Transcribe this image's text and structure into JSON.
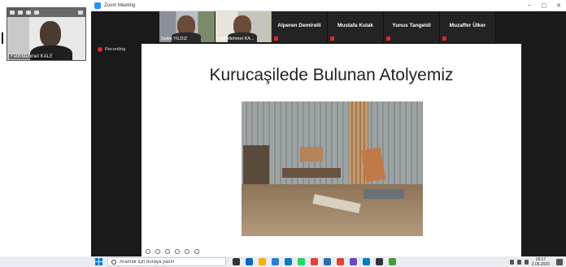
{
  "self_view": {
    "name": "FatihMehmet KALE"
  },
  "zoom": {
    "window_title": "Zoom Meeting",
    "controls": {
      "minimize": "–",
      "maximize": "▢",
      "close": "✕"
    },
    "recording_label": "Recording",
    "participants": [
      {
        "name": "Selim YILDIZ",
        "video": true,
        "active": false
      },
      {
        "name": "FatihMehmet KA...",
        "video": true,
        "active": true
      },
      {
        "name": "Alperen Demirelli",
        "video": false,
        "muted": true
      },
      {
        "name": "Mustafa Kulak",
        "video": false,
        "muted": true
      },
      {
        "name": "Yunus Tangeldi",
        "video": false,
        "muted": true
      },
      {
        "name": "Muzaffer Ülker",
        "video": false,
        "muted": true
      }
    ]
  },
  "slide": {
    "title": "Kurucaşilede Bulunan Atolyemiz"
  },
  "taskbar": {
    "search_placeholder": "Aramak için buraya yazın",
    "icon_colors": [
      "#333333",
      "#0a66c2",
      "#f0b400",
      "#2d7dd2",
      "#0a7bbf",
      "#25d366",
      "#e34133",
      "#2b6cb0",
      "#e34133",
      "#6b4bc4",
      "#0a7bbf",
      "#333333",
      "#4a9b3c"
    ],
    "time": "18:17",
    "date": "2.06.2020"
  }
}
